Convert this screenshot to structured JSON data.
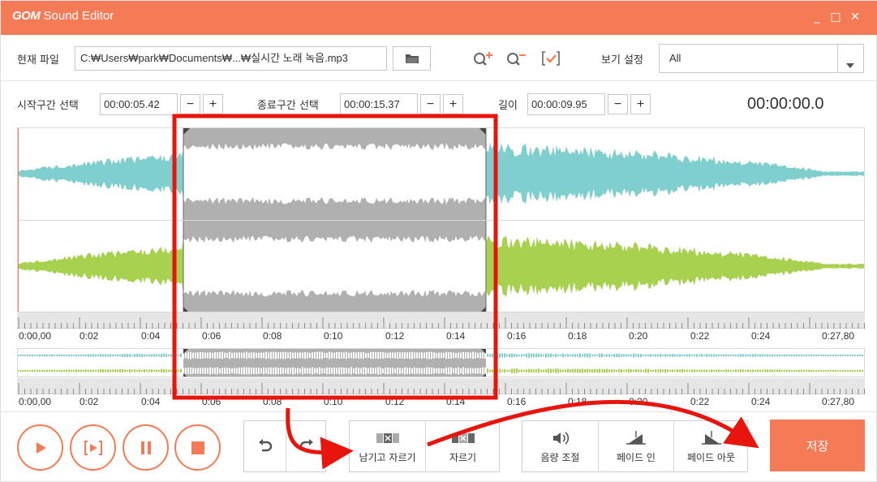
{
  "app": {
    "title_bold": "GOM",
    "title_rest": " Sound Editor"
  },
  "window_controls": {
    "minimize": "_",
    "maximize": "□",
    "close": "✕"
  },
  "file": {
    "label": "현재 파일",
    "path": "C:₩Users₩park₩Documents₩...₩실시간 노래 녹음.mp3"
  },
  "view": {
    "label": "보기 설정",
    "value": "All"
  },
  "start": {
    "label": "시작구간 선택",
    "value": "00:00:05.42"
  },
  "end": {
    "label": "종료구간 선택",
    "value": "00:00:15.37"
  },
  "length": {
    "label": "길이",
    "value": "00:00:09.95"
  },
  "stepper": {
    "minus": "−",
    "plus": "+"
  },
  "current_time": "00:00:00.0",
  "timeline": {
    "ticks": [
      "0:00,00",
      "0:02",
      "0:04",
      "0:06",
      "0:08",
      "0:10",
      "0:12",
      "0:14",
      "0:16",
      "0:18",
      "0:20",
      "0:22",
      "0:24",
      "0:27,80"
    ]
  },
  "edit": {
    "keep_trim": "남기고 자르기",
    "trim": "자르기"
  },
  "effects": {
    "volume": "음량 조절",
    "fade_in": "페이드 인",
    "fade_out": "페이드 아웃"
  },
  "save_label": "저장",
  "colors": {
    "accent": "#f47b55",
    "channel_top": "#7fcfcf",
    "channel_bottom": "#a8d14f",
    "selection": "#b0b0b0",
    "annotation": "#e8140e"
  },
  "icons": [
    "folder-icon",
    "zoom-in-icon",
    "zoom-out-icon",
    "check-icon",
    "play-icon",
    "play-selection-icon",
    "pause-icon",
    "stop-icon",
    "undo-icon",
    "redo-icon",
    "volume-icon",
    "fade-in-icon",
    "fade-out-icon"
  ]
}
